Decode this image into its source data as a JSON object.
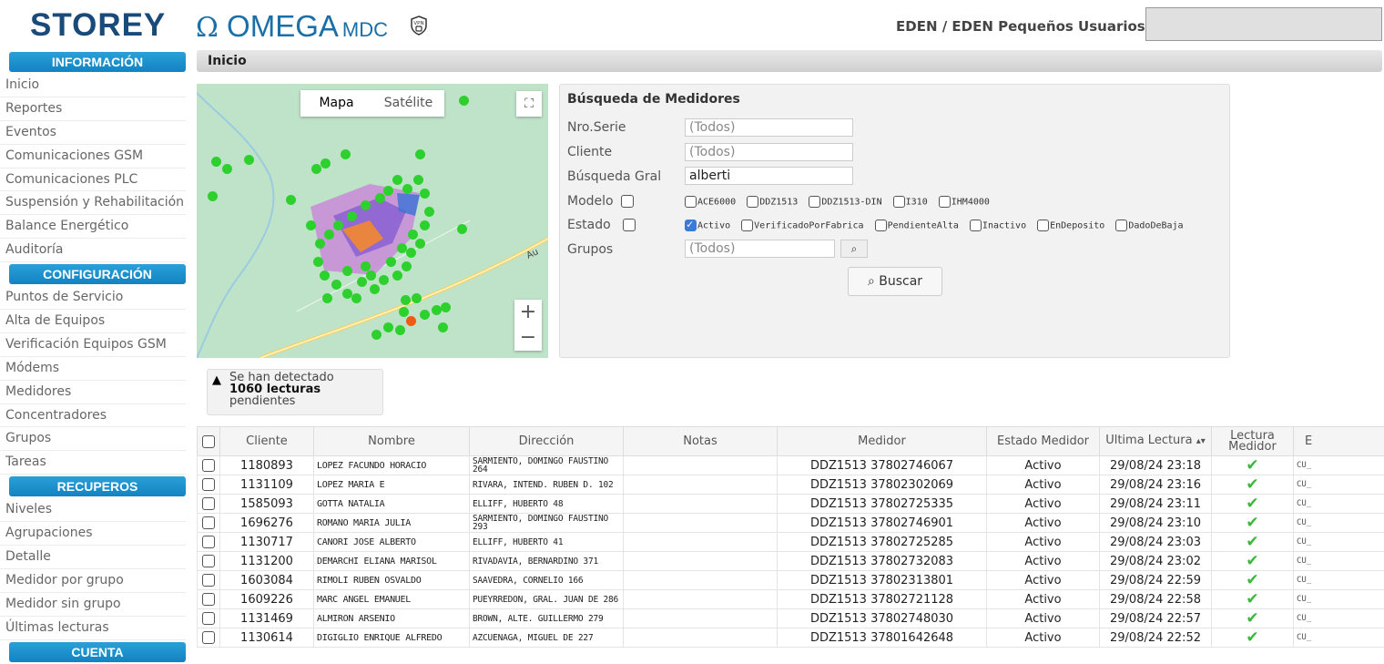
{
  "header": {
    "brand": "STOREY",
    "product_symbol": "Ω",
    "product": "OMEGA",
    "product_suffix": "MDC",
    "vpn_icon": "vpn-shield-icon",
    "org": "EDEN / EDEN Pequeños Usuarios"
  },
  "sidebar": {
    "sections": [
      {
        "title": "INFORMACIÓN",
        "items": [
          "Inicio",
          "Reportes",
          "Eventos",
          "Comunicaciones GSM",
          "Comunicaciones PLC",
          "Suspensión y Rehabilitación",
          "Balance Energético",
          "Auditoría"
        ]
      },
      {
        "title": "CONFIGURACIÓN",
        "items": [
          "Puntos de Servicio",
          "Alta de Equipos",
          "Verificación Equipos GSM",
          "Módems",
          "Medidores",
          "Concentradores",
          "Grupos",
          "Tareas"
        ]
      },
      {
        "title": "RECUPEROS",
        "items": [
          "Niveles",
          "Agrupaciones",
          "Detalle",
          "Medidor por grupo",
          "Medidor sin grupo",
          "Últimas lecturas"
        ]
      },
      {
        "title": "CUENTA",
        "items": []
      }
    ]
  },
  "page": {
    "title": "Inicio"
  },
  "map": {
    "tab_map": "Mapa",
    "tab_satellite": "Satélite",
    "zoom_in": "+",
    "zoom_out": "−",
    "road_label": "Au",
    "colors": {
      "marker": "#2ed02e",
      "alert_marker": "#f05a14"
    }
  },
  "search": {
    "title": "Búsqueda de Medidores",
    "fields": {
      "serial_label": "Nro.Serie",
      "serial_placeholder": "(Todos)",
      "client_label": "Cliente",
      "client_placeholder": "(Todos)",
      "general_label": "Búsqueda Gral",
      "general_value": "alberti",
      "model_label": "Modelo",
      "state_label": "Estado",
      "groups_label": "Grupos",
      "groups_placeholder": "(Todos)"
    },
    "models": [
      "ACE6000",
      "DDZ1513",
      "DDZ1513-DIN",
      "I310",
      "IHM4000"
    ],
    "states": [
      {
        "label": "Activo",
        "checked": true
      },
      {
        "label": "VerificadoPorFabrica",
        "checked": false
      },
      {
        "label": "PendienteAlta",
        "checked": false
      },
      {
        "label": "Inactivo",
        "checked": false
      },
      {
        "label": "EnDeposito",
        "checked": false
      },
      {
        "label": "DadoDeBaja",
        "checked": false
      }
    ],
    "button": "Buscar"
  },
  "alert": {
    "line1": "Se han detectado",
    "line2": "1060 lecturas",
    "line3": "pendientes"
  },
  "table": {
    "columns": [
      "Cliente",
      "Nombre",
      "Dirección",
      "Notas",
      "Medidor",
      "Estado Medidor",
      "Ultima Lectura",
      "Lectura Medidor",
      "E"
    ],
    "rows": [
      {
        "cliente": "1180893",
        "nombre": "LOPEZ FACUNDO HORACIO",
        "direccion": "SARMIENTO, DOMINGO FAUSTINO 264",
        "medidor": "DDZ1513 37802746067",
        "estado": "Activo",
        "lectura": "29/08/24 23:18",
        "e": "CU_"
      },
      {
        "cliente": "1131109",
        "nombre": "LOPEZ MARIA E",
        "direccion": "RIVARA, INTEND. RUBEN D. 102",
        "medidor": "DDZ1513 37802302069",
        "estado": "Activo",
        "lectura": "29/08/24 23:16",
        "e": "CU_"
      },
      {
        "cliente": "1585093",
        "nombre": "GOTTA NATALIA",
        "direccion": "ELLIFF, HUBERTO 48",
        "medidor": "DDZ1513 37802725335",
        "estado": "Activo",
        "lectura": "29/08/24 23:11",
        "e": "CU_"
      },
      {
        "cliente": "1696276",
        "nombre": "ROMANO MARIA JULIA",
        "direccion": "SARMIENTO, DOMINGO FAUSTINO 293",
        "medidor": "DDZ1513 37802746901",
        "estado": "Activo",
        "lectura": "29/08/24 23:10",
        "e": "CU_"
      },
      {
        "cliente": "1130717",
        "nombre": "CANORI JOSE ALBERTO",
        "direccion": "ELLIFF, HUBERTO 41",
        "medidor": "DDZ1513 37802725285",
        "estado": "Activo",
        "lectura": "29/08/24 23:03",
        "e": "CU_"
      },
      {
        "cliente": "1131200",
        "nombre": "DEMARCHI ELIANA MARISOL",
        "direccion": "RIVADAVIA, BERNARDINO 371",
        "medidor": "DDZ1513 37802732083",
        "estado": "Activo",
        "lectura": "29/08/24 23:02",
        "e": "CU_"
      },
      {
        "cliente": "1603084",
        "nombre": "RIMOLI RUBEN OSVALDO",
        "direccion": "SAAVEDRA, CORNELIO 166",
        "medidor": "DDZ1513 37802313801",
        "estado": "Activo",
        "lectura": "29/08/24 22:59",
        "e": "CU_"
      },
      {
        "cliente": "1609226",
        "nombre": "MARC ANGEL EMANUEL",
        "direccion": "PUEYRREDON, GRAL. JUAN DE 286",
        "medidor": "DDZ1513 37802721128",
        "estado": "Activo",
        "lectura": "29/08/24 22:58",
        "e": "CU_"
      },
      {
        "cliente": "1131469",
        "nombre": "ALMIRON ARSENIO",
        "direccion": "BROWN, ALTE. GUILLERMO 279",
        "medidor": "DDZ1513 37802748030",
        "estado": "Activo",
        "lectura": "29/08/24 22:57",
        "e": "CU_"
      },
      {
        "cliente": "1130614",
        "nombre": "DIGIGLIO ENRIQUE ALFREDO",
        "direccion": "AZCUENAGA, MIGUEL DE 227",
        "medidor": "DDZ1513 37801642648",
        "estado": "Activo",
        "lectura": "29/08/24 22:52",
        "e": "CU_"
      }
    ]
  }
}
